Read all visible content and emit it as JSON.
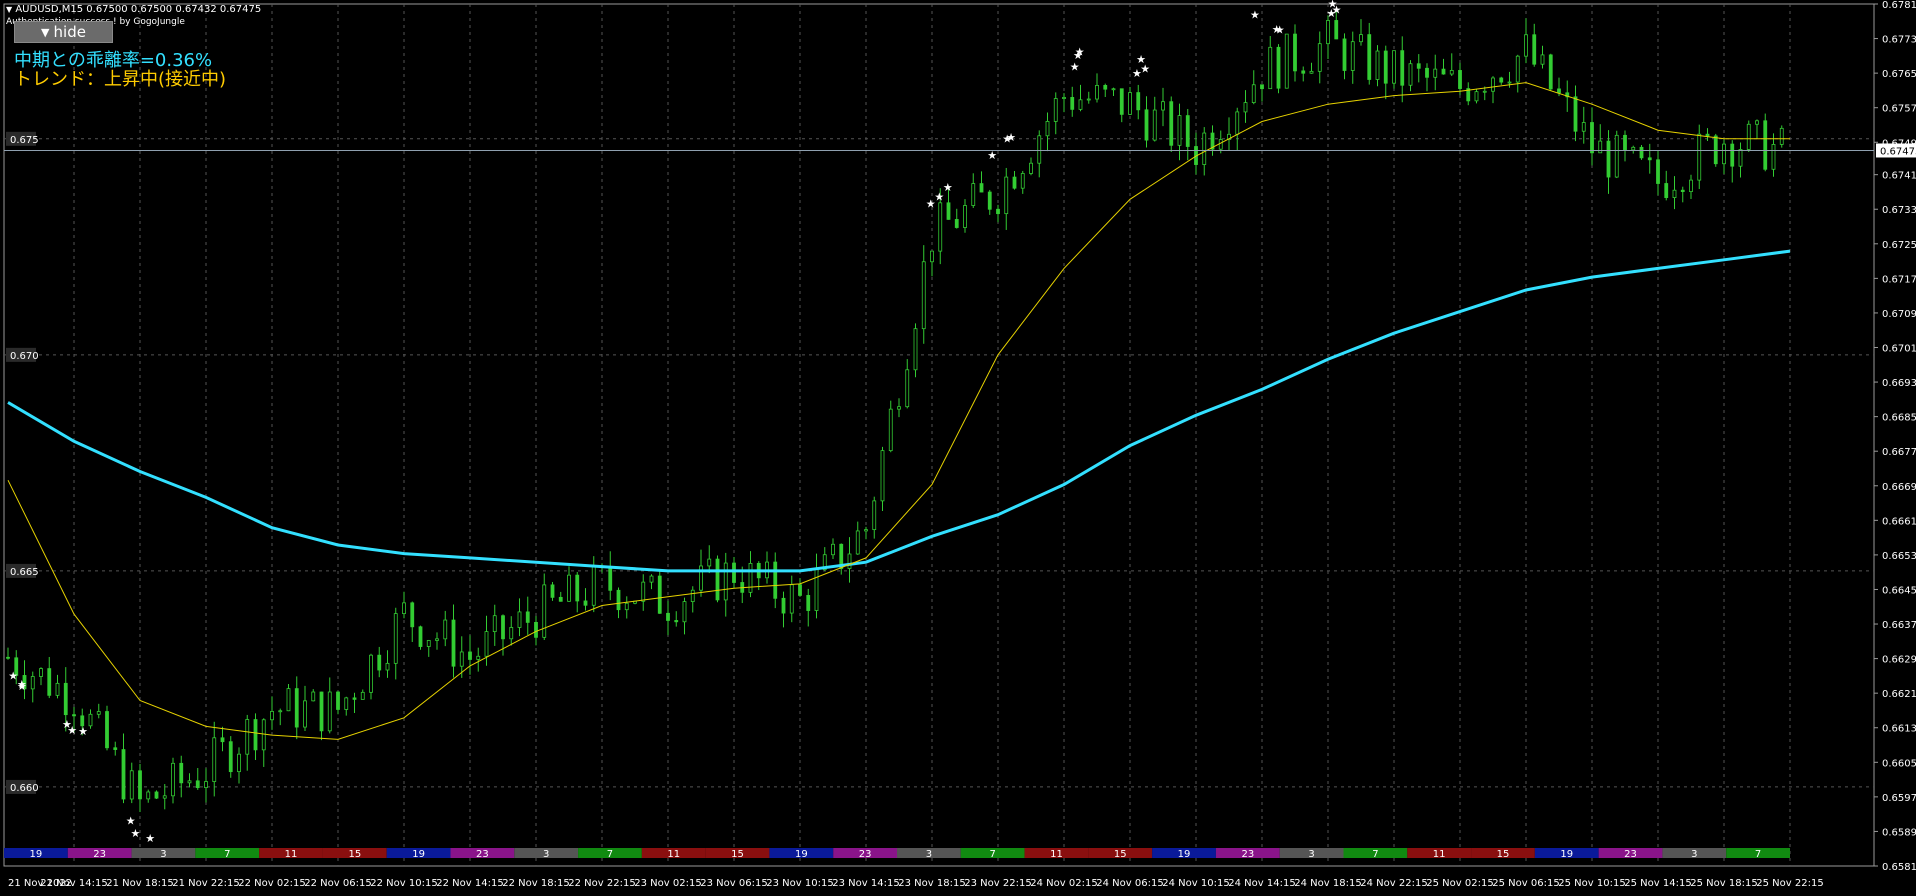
{
  "header": {
    "symbol_info": "AUDUSD,M15  0.67500 0.67500 0.67432 0.67475",
    "auth_text": "Authentication success ! by GogoJungle",
    "hide_button": "hide"
  },
  "indicator": {
    "deviation_text": "中期との乖離率=0.36%",
    "trend_text": "トレンド：上昇中(接近中)"
  },
  "colors": {
    "background": "#000000",
    "candle": "#33cc33",
    "ma_long": "#33e0ff",
    "ma_mid": "#e6d200",
    "grid": "#555555",
    "star": "#ffffff"
  },
  "price_axis": {
    "ticks": [
      "0.67812",
      "0.67732",
      "0.67652",
      "0.67572",
      "0.67492",
      "0.67417",
      "0.67337",
      "0.67257",
      "0.67177",
      "0.67097",
      "0.67017",
      "0.66937",
      "0.66857",
      "0.66777",
      "0.66697",
      "0.66617",
      "0.66537",
      "0.66457",
      "0.66377",
      "0.66297",
      "0.66217",
      "0.66137",
      "0.66057",
      "0.65977",
      "0.65897",
      "0.65817"
    ],
    "current_price": "0.67473",
    "left_levels": [
      "0.675",
      "0.670",
      "0.665",
      "0.660"
    ]
  },
  "time_axis": {
    "labels": [
      "21 Nov 2022",
      "21 Nov 14:15",
      "21 Nov 18:15",
      "21 Nov 22:15",
      "22 Nov 02:15",
      "22 Nov 06:15",
      "22 Nov 10:15",
      "22 Nov 14:15",
      "22 Nov 18:15",
      "22 Nov 22:15",
      "23 Nov 02:15",
      "23 Nov 06:15",
      "23 Nov 10:15",
      "23 Nov 14:15",
      "23 Nov 18:15",
      "23 Nov 22:15",
      "24 Nov 02:15",
      "24 Nov 06:15",
      "24 Nov 10:15",
      "24 Nov 14:15",
      "24 Nov 18:15",
      "24 Nov 22:15",
      "25 Nov 02:15",
      "25 Nov 06:15",
      "25 Nov 10:15",
      "25 Nov 14:15",
      "25 Nov 18:15",
      "25 Nov 22:15"
    ]
  },
  "session_bar": {
    "segments": [
      {
        "label": "19",
        "color": "#0a1a9a"
      },
      {
        "label": "23",
        "color": "#8a148a"
      },
      {
        "label": "3",
        "color": "#555555"
      },
      {
        "label": "7",
        "color": "#118a11"
      },
      {
        "label": "11",
        "color": "#8a0f0f"
      },
      {
        "label": "15",
        "color": "#8a0f0f"
      },
      {
        "label": "19",
        "color": "#0a1a9a"
      },
      {
        "label": "23",
        "color": "#8a148a"
      },
      {
        "label": "3",
        "color": "#555555"
      },
      {
        "label": "7",
        "color": "#118a11"
      },
      {
        "label": "11",
        "color": "#8a0f0f"
      },
      {
        "label": "15",
        "color": "#8a0f0f"
      },
      {
        "label": "19",
        "color": "#0a1a9a"
      },
      {
        "label": "23",
        "color": "#8a148a"
      },
      {
        "label": "3",
        "color": "#555555"
      },
      {
        "label": "7",
        "color": "#118a11"
      },
      {
        "label": "11",
        "color": "#8a0f0f"
      },
      {
        "label": "15",
        "color": "#8a0f0f"
      },
      {
        "label": "19",
        "color": "#0a1a9a"
      },
      {
        "label": "23",
        "color": "#8a148a"
      },
      {
        "label": "3",
        "color": "#555555"
      },
      {
        "label": "7",
        "color": "#118a11"
      },
      {
        "label": "11",
        "color": "#8a0f0f"
      },
      {
        "label": "15",
        "color": "#8a0f0f"
      },
      {
        "label": "19",
        "color": "#0a1a9a"
      },
      {
        "label": "23",
        "color": "#8a148a"
      },
      {
        "label": "3",
        "color": "#555555"
      },
      {
        "label": "7",
        "color": "#118a11"
      }
    ]
  },
  "chart_data": {
    "type": "line",
    "series": [
      {
        "name": "AUDUSD",
        "x": [
          "21 Nov 2022",
          "21 Nov 14:15",
          "21 Nov 18:15",
          "21 Nov 22:15",
          "22 Nov 02:15",
          "22 Nov 06:15",
          "22 Nov 10:15",
          "22 Nov 14:15",
          "22 Nov 18:15",
          "22 Nov 22:15",
          "23 Nov 02:15",
          "23 Nov 06:15",
          "23 Nov 10:15",
          "23 Nov 14:15",
          "23 Nov 18:15",
          "23 Nov 22:15",
          "24 Nov 02:15",
          "24 Nov 06:15",
          "24 Nov 10:15",
          "24 Nov 14:15",
          "24 Nov 18:15",
          "24 Nov 22:15",
          "25 Nov 02:15",
          "25 Nov 06:15",
          "25 Nov 10:15",
          "25 Nov 14:15",
          "25 Nov 18:15",
          "25 Nov 22:15"
        ],
        "values": [
          0.663,
          0.6621,
          0.6596,
          0.6604,
          0.6618,
          0.6618,
          0.664,
          0.663,
          0.664,
          0.6647,
          0.6643,
          0.665,
          0.6643,
          0.666,
          0.6728,
          0.6738,
          0.676,
          0.6758,
          0.6748,
          0.6766,
          0.6772,
          0.6765,
          0.6762,
          0.677,
          0.6748,
          0.674,
          0.675,
          0.6747
        ]
      },
      {
        "name": "",
        "x": [
          "21 Nov 2022",
          "21 Nov 14:15",
          "21 Nov 18:15",
          "21 Nov 22:15",
          "22 Nov 02:15",
          "22 Nov 06:15",
          "22 Nov 10:15",
          "22 Nov 14:15",
          "22 Nov 18:15",
          "22 Nov 22:15",
          "23 Nov 02:15",
          "23 Nov 06:15",
          "23 Nov 10:15",
          "23 Nov 14:15",
          "23 Nov 18:15",
          "23 Nov 22:15",
          "24 Nov 02:15",
          "24 Nov 06:15",
          "24 Nov 10:15",
          "24 Nov 14:15",
          "24 Nov 18:15",
          "24 Nov 22:15",
          "25 Nov 02:15",
          "25 Nov 06:15",
          "25 Nov 10:15",
          "25 Nov 14:15",
          "25 Nov 18:15",
          "25 Nov 22:15"
        ],
        "values": [
          0.6689,
          0.668,
          0.6673,
          0.6667,
          0.666,
          0.6656,
          0.6654,
          0.6653,
          0.6652,
          0.6651,
          0.665,
          0.665,
          0.665,
          0.6652,
          0.6658,
          0.6663,
          0.667,
          0.6679,
          0.6686,
          0.6692,
          0.6699,
          0.6705,
          0.671,
          0.6715,
          0.6718,
          0.672,
          0.6722,
          0.6724
        ]
      },
      {
        "name": "",
        "x": [
          "21 Nov 2022",
          "21 Nov 14:15",
          "21 Nov 18:15",
          "21 Nov 22:15",
          "22 Nov 02:15",
          "22 Nov 06:15",
          "22 Nov 10:15",
          "22 Nov 14:15",
          "22 Nov 18:15",
          "22 Nov 22:15",
          "23 Nov 02:15",
          "23 Nov 06:15",
          "23 Nov 10:15",
          "23 Nov 14:15",
          "23 Nov 18:15",
          "23 Nov 22:15",
          "24 Nov 02:15",
          "24 Nov 06:15",
          "24 Nov 10:15",
          "24 Nov 14:15",
          "24 Nov 18:15",
          "24 Nov 22:15",
          "25 Nov 02:15",
          "25 Nov 06:15",
          "25 Nov 10:15",
          "25 Nov 14:15",
          "25 Nov 18:15",
          "25 Nov 22:15"
        ],
        "values": [
          0.6671,
          0.664,
          0.662,
          0.6614,
          0.6612,
          0.6611,
          0.6616,
          0.6628,
          0.6636,
          0.6642,
          0.6644,
          0.6646,
          0.6647,
          0.6653,
          0.667,
          0.67,
          0.672,
          0.6736,
          0.6746,
          0.6754,
          0.6758,
          0.676,
          0.6761,
          0.6763,
          0.6758,
          0.6752,
          0.675,
          0.675
        ]
      }
    ],
    "ylim": [
      0.65817,
      0.67812
    ],
    "grid": true
  }
}
